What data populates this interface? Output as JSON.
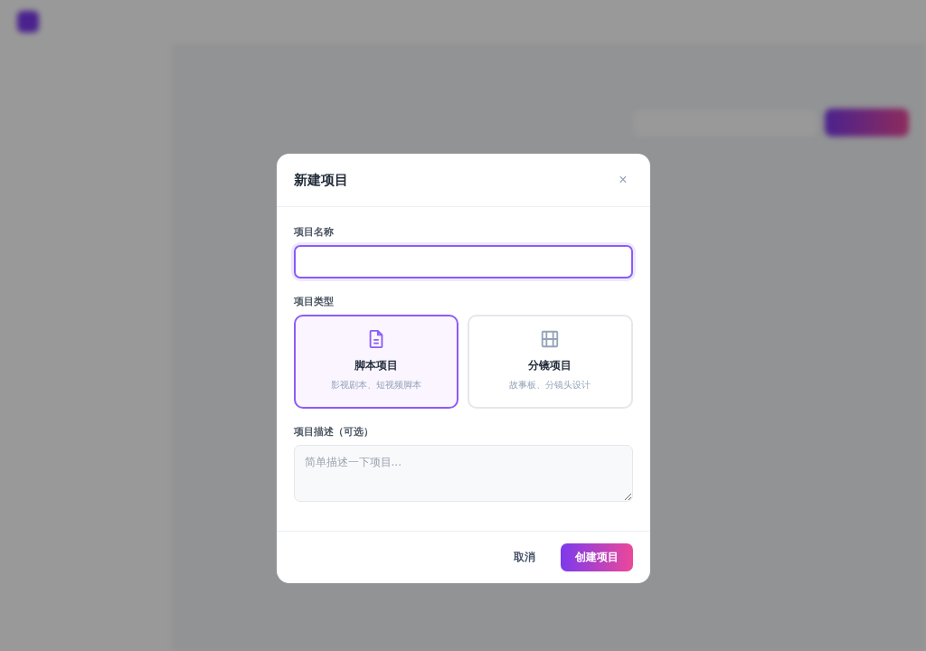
{
  "dialog": {
    "title": "新建项目",
    "close": "×",
    "name_field": {
      "label": "项目名称"
    },
    "type_field": {
      "label": "项目类型",
      "options": [
        {
          "kind": "script",
          "title": "脚本项目",
          "subtitle": "影视剧本、短视频脚本",
          "selected": true
        },
        {
          "kind": "storyboard",
          "title": "分镜项目",
          "subtitle": "故事板、分镜头设计",
          "selected": false
        }
      ]
    },
    "description_field": {
      "label": "项目描述（可选）",
      "placeholder": "简单描述一下项目..."
    },
    "buttons": [
      {
        "kind": "secondary",
        "label": "取消"
      },
      {
        "kind": "primary",
        "label": "创建项目"
      }
    ]
  }
}
